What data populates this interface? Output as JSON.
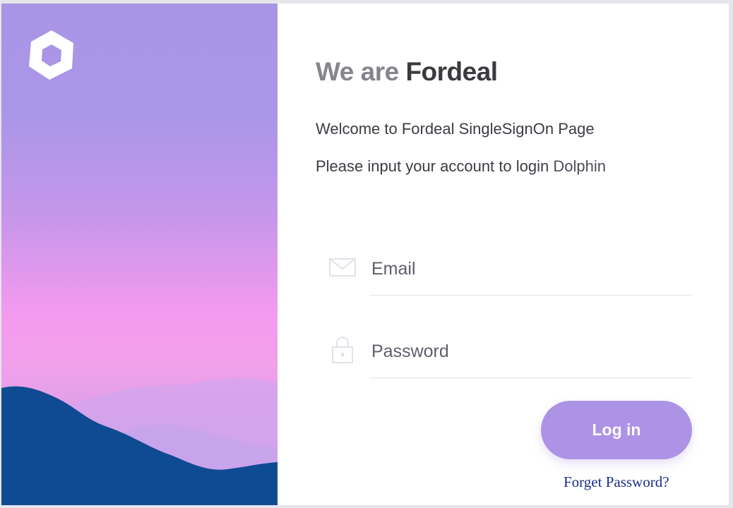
{
  "hero": {
    "logo_icon": "hexagon-ring-logo-icon",
    "colors": {
      "top": "#a994e6",
      "middle": "#f49aef",
      "mountain_far": "#d4a6ec",
      "mountain_near": "#0f4b92"
    }
  },
  "header": {
    "title_lead": "We are",
    "title_brand": "Fordeal"
  },
  "intro": {
    "welcome": "Welcome to Fordeal SingleSignOn Page",
    "instruction": "Please input your account to login",
    "app_name": "Dolphin"
  },
  "form": {
    "email": {
      "icon": "envelope-icon",
      "placeholder": "Email",
      "value": ""
    },
    "password": {
      "icon": "lock-icon",
      "placeholder": "Password",
      "value": ""
    },
    "login_label": "Log in",
    "forgot_label": "Forget Password?"
  },
  "colors": {
    "accent": "#ad93e6",
    "link": "#1a2f8c",
    "title": "#3a3a3f",
    "title_lead": "#86858c"
  }
}
